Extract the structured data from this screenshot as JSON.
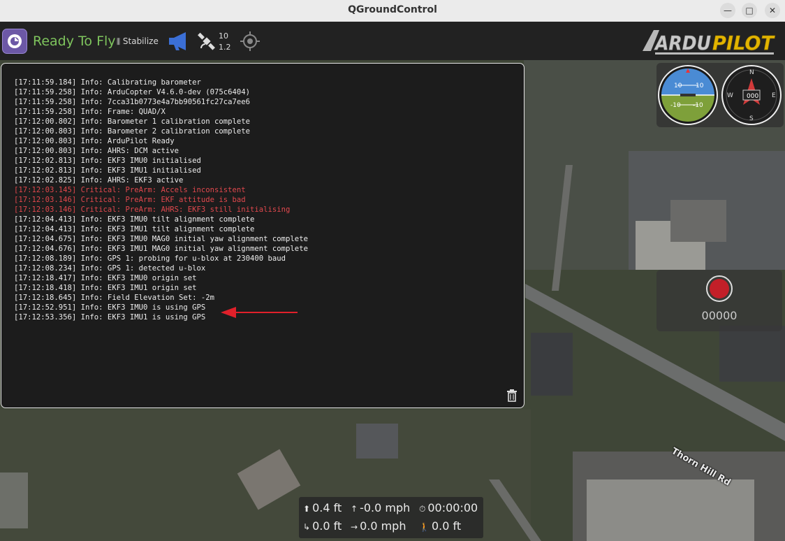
{
  "window": {
    "title": "QGroundControl",
    "controls": {
      "minimize": "—",
      "maximize": "□",
      "close": "✕"
    }
  },
  "toolbar": {
    "status": "Ready To Fly",
    "flight_mode": "Stabilize",
    "gps": {
      "satellites": "10",
      "hdop": "1.2"
    },
    "brand_logo": "ArduPilot",
    "icons": [
      "qgc-logo-icon",
      "flight-mode-icon",
      "megaphone-icon",
      "satellite-icon",
      "target-icon"
    ]
  },
  "console": {
    "lines": [
      {
        "text": "[17:11:59.184] Info: Calibrating barometer",
        "level": "info"
      },
      {
        "text": "[17:11:59.258] Info: ArduCopter V4.6.0-dev (075c6404)",
        "level": "info"
      },
      {
        "text": "[17:11:59.258] Info: 7cca31b0773e4a7bb90561fc27ca7ee6",
        "level": "info"
      },
      {
        "text": "[17:11:59.258] Info: Frame: QUAD/X",
        "level": "info"
      },
      {
        "text": "[17:12:00.802] Info: Barometer 1 calibration complete",
        "level": "info"
      },
      {
        "text": "[17:12:00.803] Info: Barometer 2 calibration complete",
        "level": "info"
      },
      {
        "text": "[17:12:00.803] Info: ArduPilot Ready",
        "level": "info"
      },
      {
        "text": "[17:12:00.803] Info: AHRS: DCM active",
        "level": "info"
      },
      {
        "text": "[17:12:02.813] Info: EKF3 IMU0 initialised",
        "level": "info"
      },
      {
        "text": "[17:12:02.813] Info: EKF3 IMU1 initialised",
        "level": "info"
      },
      {
        "text": "[17:12:02.825] Info: AHRS: EKF3 active",
        "level": "info"
      },
      {
        "text": "[17:12:03.145] Critical: PreArm: Accels inconsistent",
        "level": "critical"
      },
      {
        "text": "[17:12:03.146] Critical: PreArm: EKF attitude is bad",
        "level": "critical"
      },
      {
        "text": "[17:12:03.146] Critical: PreArm: AHRS: EKF3 still initialising",
        "level": "critical"
      },
      {
        "text": "[17:12:04.413] Info: EKF3 IMU0 tilt alignment complete",
        "level": "info"
      },
      {
        "text": "[17:12:04.413] Info: EKF3 IMU1 tilt alignment complete",
        "level": "info"
      },
      {
        "text": "[17:12:04.675] Info: EKF3 IMU0 MAG0 initial yaw alignment complete",
        "level": "info"
      },
      {
        "text": "[17:12:04.676] Info: EKF3 IMU1 MAG0 initial yaw alignment complete",
        "level": "info"
      },
      {
        "text": "[17:12:08.189] Info: GPS 1: probing for u-blox at 230400 baud",
        "level": "info"
      },
      {
        "text": "[17:12:08.234] Info: GPS 1: detected u-blox",
        "level": "info"
      },
      {
        "text": "[17:12:18.417] Info: EKF3 IMU0 origin set",
        "level": "info"
      },
      {
        "text": "[17:12:18.418] Info: EKF3 IMU1 origin set",
        "level": "info"
      },
      {
        "text": "[17:12:18.645] Info: Field Elevation Set: -2m",
        "level": "info"
      },
      {
        "text": "[17:12:52.951] Info: EKF3 IMU0 is using GPS",
        "level": "info"
      },
      {
        "text": "[17:12:53.356] Info: EKF3 IMU1 is using GPS",
        "level": "info"
      }
    ],
    "annotation_color": "#e0202a",
    "clear_icon": "trash-icon"
  },
  "instruments": {
    "attitude": {
      "pitch_labels": [
        "10",
        "10",
        "-10",
        "-10"
      ]
    },
    "compass": {
      "heading": "000",
      "cardinals": [
        "N",
        "E",
        "S",
        "W"
      ]
    }
  },
  "recording": {
    "counter": "00000"
  },
  "telemetry": {
    "altitude": "0.4 ft",
    "vertical_speed": "-0.0 mph",
    "flight_time": "00:00:00",
    "distance": "0.0 ft",
    "ground_speed": "0.0 mph",
    "distance_to_home": "0.0 ft"
  },
  "map": {
    "road_label": "Thorn Hill Rd"
  },
  "colors": {
    "ready": "#7ec45d",
    "critical": "#e0484d",
    "record": "#c21f28",
    "megaphone": "#3b6fd6"
  }
}
